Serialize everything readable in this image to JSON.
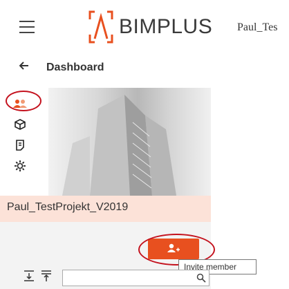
{
  "header": {
    "brand": "BIMPLUS",
    "user": "Paul_Tes",
    "menu_icon": "hamburger-menu-icon",
    "logo_icon": "bimplus-logo-icon"
  },
  "breadcrumb": {
    "back_icon": "arrow-left-icon",
    "label": "Dashboard"
  },
  "sidebar": {
    "items": [
      {
        "icon": "members-icon",
        "highlighted": true
      },
      {
        "icon": "cube-icon"
      },
      {
        "icon": "document-icon"
      },
      {
        "icon": "gear-icon"
      }
    ]
  },
  "project": {
    "name": "Paul_TestProjekt_V2019",
    "image": "building-photo"
  },
  "actions": {
    "invite_icon": "add-member-icon",
    "invite_tooltip": "Invite member"
  },
  "toolbar": {
    "tools": [
      {
        "icon": "collapse-all-icon"
      },
      {
        "icon": "expand-all-icon"
      }
    ],
    "search_value": "",
    "search_icon": "search-icon"
  },
  "colors": {
    "accent": "#e8501f",
    "highlight_ring": "#c4121e",
    "project_bar": "#fce2d8",
    "logo": "#e8501f"
  }
}
